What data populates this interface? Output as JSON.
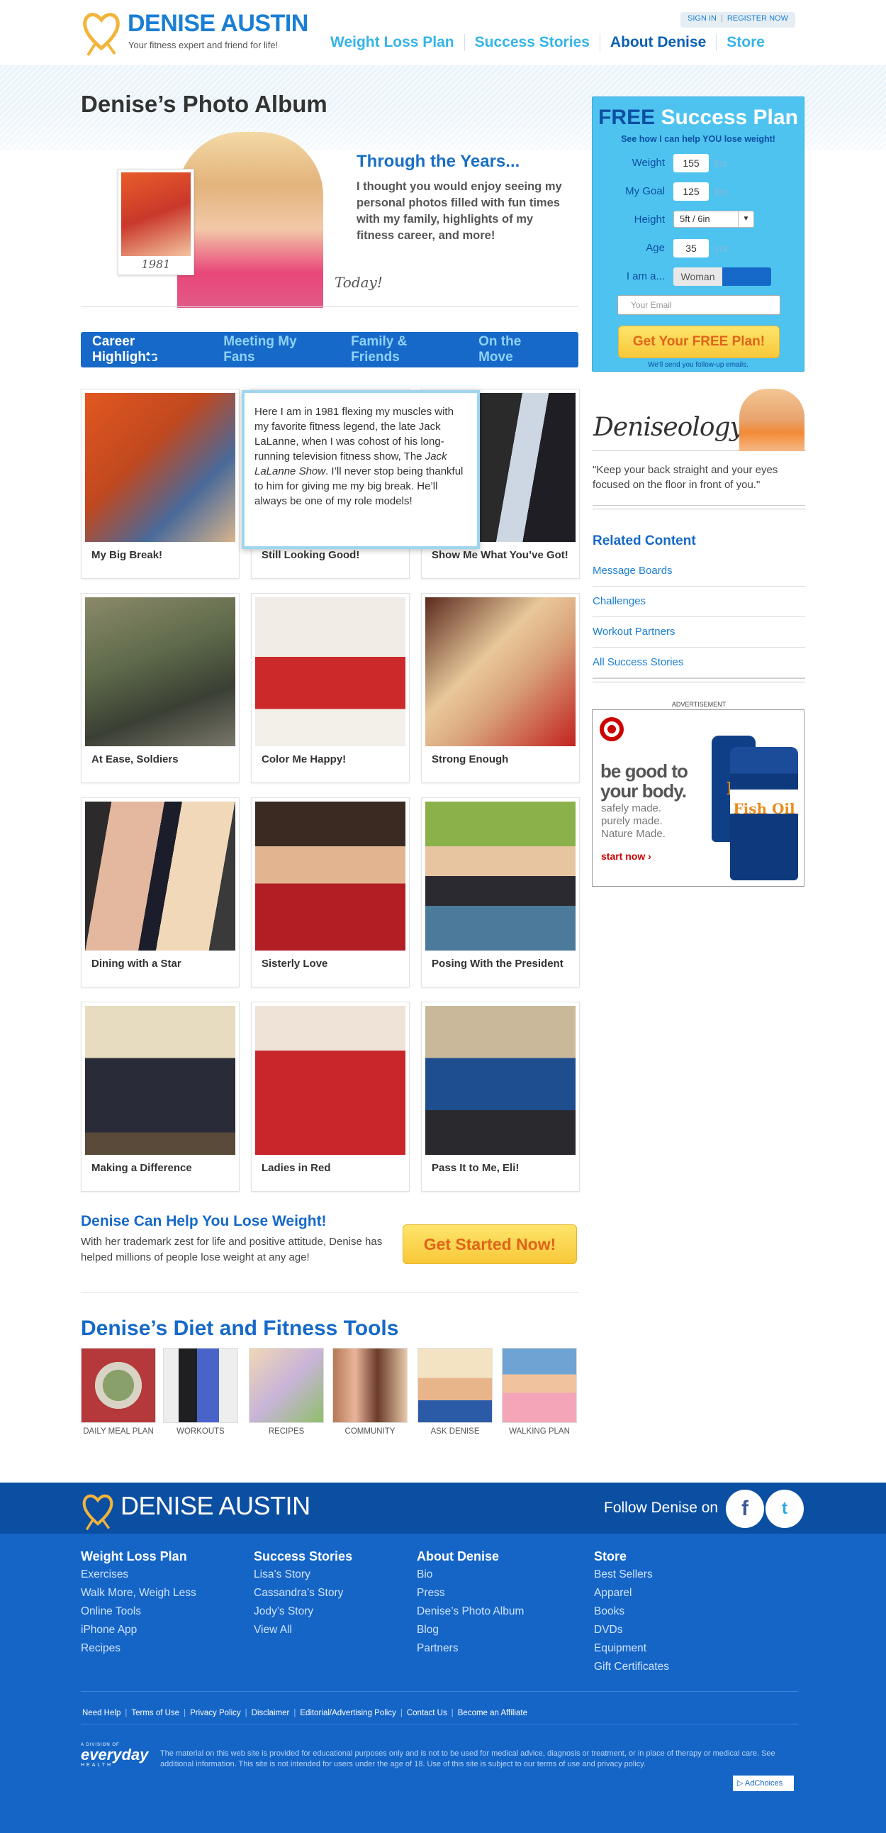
{
  "brand": {
    "name": "DENISE AUSTIN",
    "tagline": "Your fitness expert and friend for life!"
  },
  "top_links": {
    "signin": "SIGN IN",
    "register": "REGISTER NOW"
  },
  "nav": [
    {
      "label": "Weight Loss Plan",
      "active": false
    },
    {
      "label": "Success Stories",
      "active": false
    },
    {
      "label": "About Denise",
      "active": true
    },
    {
      "label": "Store",
      "active": false
    }
  ],
  "page_title": "Denise’s Photo Album",
  "hero": {
    "small_caption": "1981",
    "today": "Today!",
    "heading": "Through the Years...",
    "body": "I thought you would enjoy seeing my personal photos filled with fun times with my family, highlights of my fitness career, and more!"
  },
  "tabs": [
    {
      "label": "Career Highlights",
      "active": true
    },
    {
      "label": "Meeting My Fans",
      "active": false
    },
    {
      "label": "Family & Friends",
      "active": false
    },
    {
      "label": "On the Move",
      "active": false
    }
  ],
  "gallery": [
    {
      "caption": "My Big Break!"
    },
    {
      "caption": "Still Looking Good!"
    },
    {
      "caption": "Show Me What You’ve Got!"
    },
    {
      "caption": "At Ease, Soldiers"
    },
    {
      "caption": "Color Me Happy!"
    },
    {
      "caption": "Strong Enough"
    },
    {
      "caption": "Dining with a Star"
    },
    {
      "caption": "Sisterly Love"
    },
    {
      "caption": "Posing With the President"
    },
    {
      "caption": "Making a Difference"
    },
    {
      "caption": "Ladies in Red"
    },
    {
      "caption": "Pass It to Me, Eli!"
    }
  ],
  "tooltip": {
    "text_before": "Here I am in 1981 flexing my muscles with my favorite fitness legend, the late Jack LaLanne, when I was cohost of his long-running television fitness show, The ",
    "show": "Jack LaLanne Show",
    "text_after": ". I’ll never stop being thankful to him for giving me my big break. He’ll always be one of my role models!"
  },
  "cta": {
    "title": "Denise Can Help You Lose Weight!",
    "body": "With her trademark zest for life and positive attitude, Denise has helped millions of people lose weight at any age!",
    "button": "Get Started Now!"
  },
  "tools": {
    "title": "Denise’s Diet and Fitness Tools",
    "items": [
      "DAILY MEAL PLAN",
      "WORKOUTS",
      "RECIPES",
      "COMMUNITY",
      "ASK DENISE",
      "WALKING PLAN"
    ]
  },
  "plan": {
    "title_free": "FREE",
    "title_rest": "Success Plan",
    "subtitle": "See how I can help YOU lose weight!",
    "weight_label": "Weight",
    "weight_value": "155",
    "weight_unit": "lbs",
    "goal_label": "My Goal",
    "goal_value": "125",
    "goal_unit": "lbs",
    "height_label": "Height",
    "height_value": "5ft / 6in",
    "age_label": "Age",
    "age_value": "35",
    "age_unit": "yrs",
    "gender_label": "I am a...",
    "gender_woman": "Woman",
    "gender_man": "Man",
    "email_placeholder": "Your Email",
    "button": "Get Your FREE Plan!",
    "note": "We'll send you follow-up emails."
  },
  "deniseology": {
    "word": "Deniseology",
    "quote": "\"Keep your back straight and your eyes focused on the floor in front of you.\""
  },
  "related": {
    "title": "Related Content",
    "items": [
      "Message Boards",
      "Challenges",
      "Workout Partners",
      "All Success Stories"
    ]
  },
  "ad": {
    "label": "ADVERTISEMENT",
    "headline_1": "be good to",
    "headline_2": "your body.",
    "line_1": "safely made.",
    "line_2": "purely made.",
    "line_3": "Nature Made.",
    "start": "start now ›",
    "bottle_front": "Fish Oil",
    "bottle_back": "D"
  },
  "footer": {
    "brand": "DENISE AUSTIN",
    "follow": "Follow Denise on",
    "columns": [
      {
        "heading": "Weight Loss Plan",
        "links": [
          "Exercises",
          "Walk More, Weigh Less",
          "Online Tools",
          "iPhone App",
          "Recipes"
        ]
      },
      {
        "heading": "Success Stories",
        "links": [
          "Lisa’s Story",
          "Cassandra’s Story",
          "Jody’s Story",
          "View All"
        ]
      },
      {
        "heading": "About Denise",
        "links": [
          "Bio",
          "Press",
          "Denise’s Photo Album",
          "Blog",
          "Partners"
        ]
      },
      {
        "heading": "Store",
        "links": [
          "Best Sellers",
          "Apparel",
          "Books",
          "DVDs",
          "Equipment",
          "Gift Certificates"
        ]
      }
    ],
    "bottom_links": [
      "Need Help",
      "Terms of Use",
      "Privacy Policy",
      "Disclaimer",
      "Editorial/Advertising Policy",
      "Contact Us",
      "Become an Affiliate"
    ],
    "everyday_a": "A DIVISION OF",
    "everyday_b": "everyday",
    "everyday_c": "HEALTH",
    "disclaimer": "The material on this web site is provided for educational purposes only and is not to be used for medical advice, diagnosis or treatment, or in place of therapy or medical care. See additional information. This site is not intended for users under the age of 18. Use of this site is subject to our terms of use and privacy policy.",
    "adchoices": "AdChoices"
  },
  "colors": {
    "brand_blue": "#1669c8",
    "light_blue": "#35b4e8",
    "cta_yellow": "#f8c83a",
    "cta_orange": "#e0641a"
  }
}
